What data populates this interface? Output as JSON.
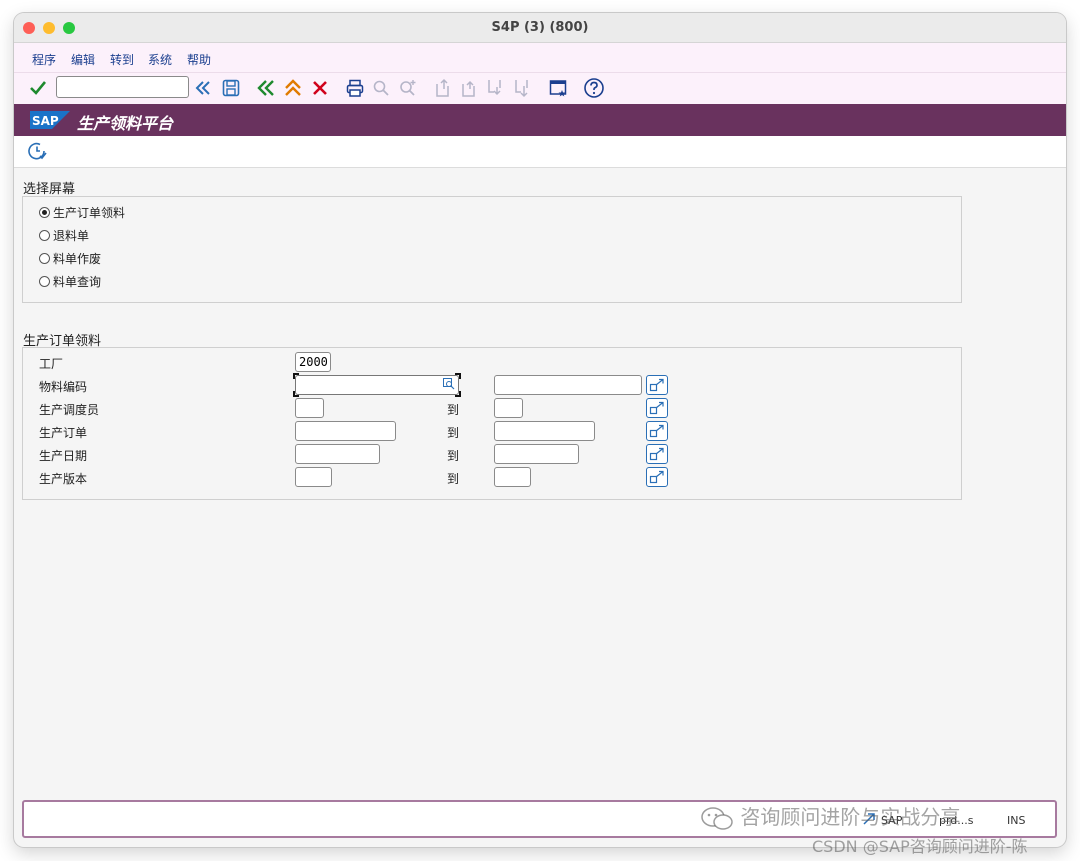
{
  "window": {
    "title": "S4P (3) (800)"
  },
  "menu": {
    "items": [
      "程序",
      "编辑",
      "转到",
      "系统",
      "帮助"
    ]
  },
  "toolbar": {
    "command_value": ""
  },
  "app": {
    "title": "生产领料平台",
    "logo": "SAP"
  },
  "selection": {
    "title": "选择屏幕",
    "options": [
      {
        "label": "生产订单领料",
        "checked": true
      },
      {
        "label": "退料单",
        "checked": false
      },
      {
        "label": "料单作废",
        "checked": false
      },
      {
        "label": "料单查询",
        "checked": false
      }
    ]
  },
  "criteria": {
    "title": "生产订单领料",
    "plant_label": "工厂",
    "plant_value": "2000",
    "to_label": "到",
    "rows": [
      {
        "label": "物料编码",
        "from": "",
        "to": ""
      },
      {
        "label": "生产调度员",
        "from": "",
        "to": ""
      },
      {
        "label": "生产订单",
        "from": "",
        "to": ""
      },
      {
        "label": "生产日期",
        "from": "",
        "to": ""
      },
      {
        "label": "生产版本",
        "from": "",
        "to": ""
      }
    ]
  },
  "status": {
    "system_info_1": "SAP",
    "system_info_2": "prd...s",
    "system_info_3": "INS"
  },
  "watermark": {
    "line1": "咨询顾问进阶与实战分享",
    "line2": "CSDN @SAP咨询顾问进阶-陈"
  },
  "colors": {
    "appbar": "#69325e",
    "accent": "#2a6fb6",
    "confirm": "#1e8a2e",
    "cancel": "#d0021b",
    "nav": "#e07b00"
  }
}
